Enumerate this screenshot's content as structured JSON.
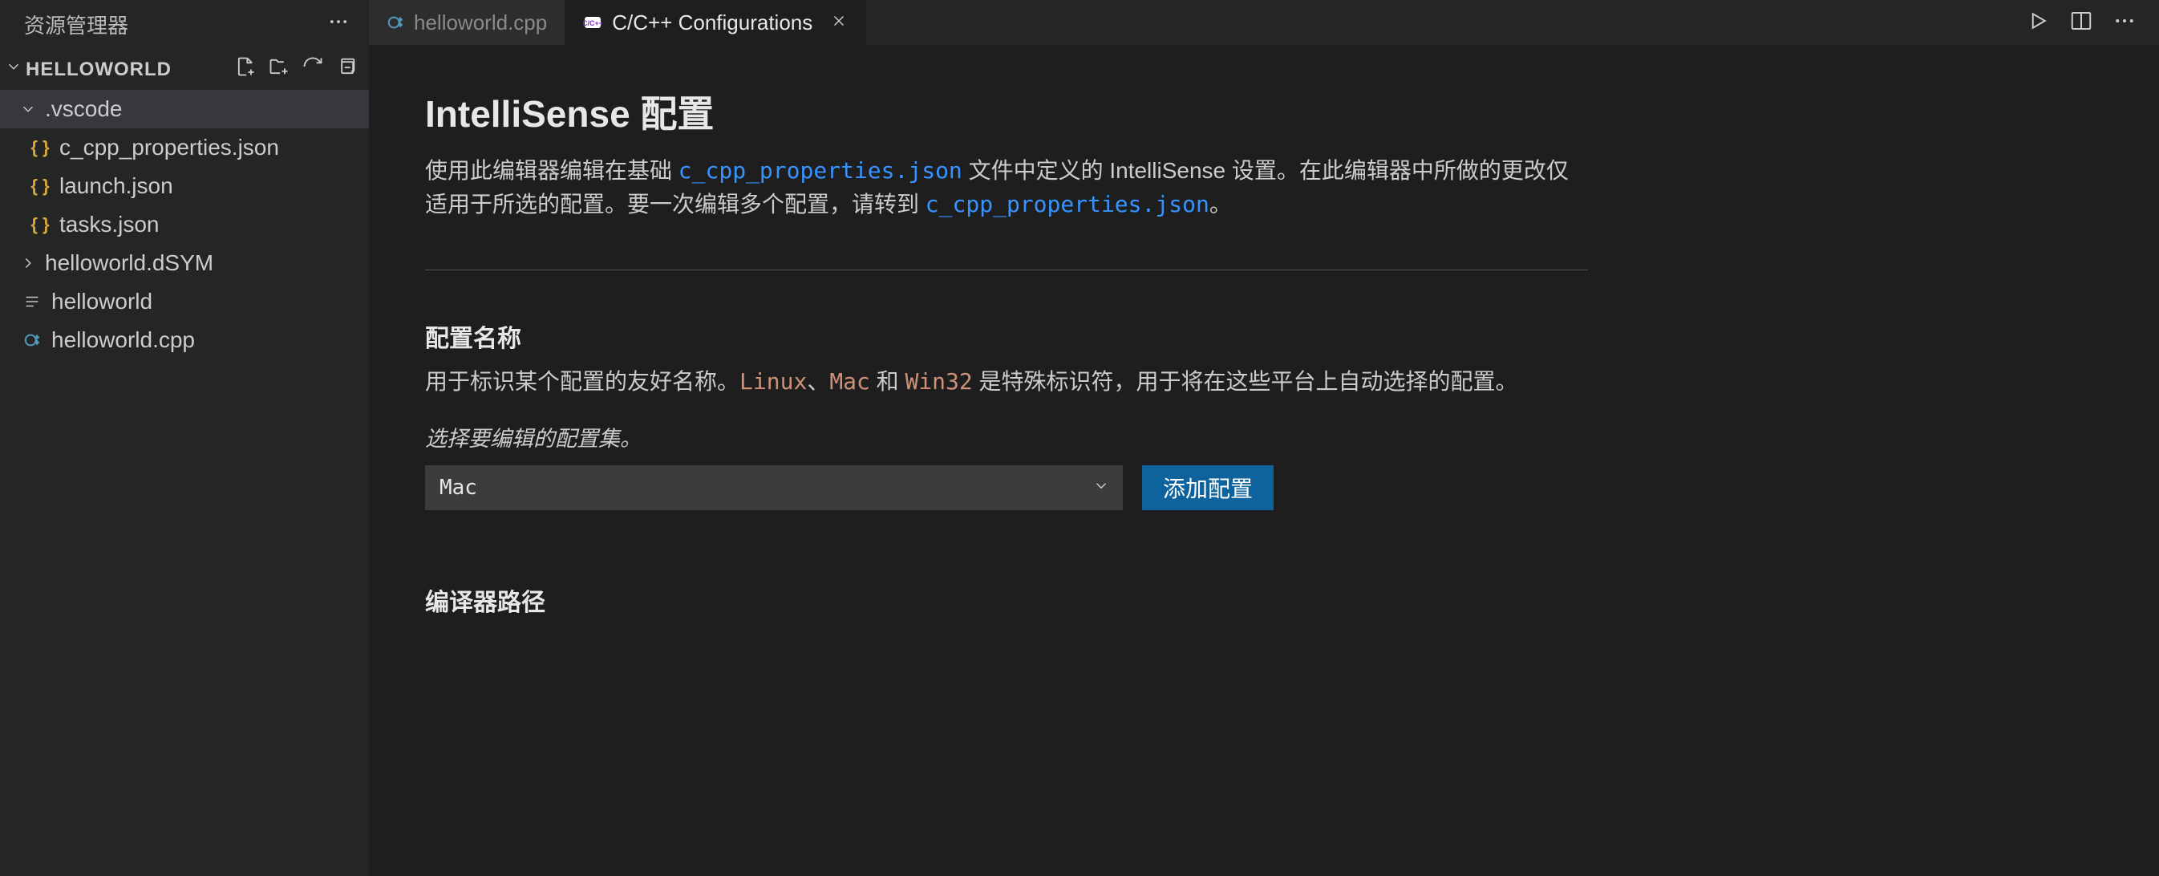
{
  "sidebar": {
    "title": "资源管理器",
    "project_name": "HELLOWORLD",
    "tree": [
      {
        "label": ".vscode",
        "type": "folder",
        "expanded": true,
        "selected": true
      },
      {
        "label": "c_cpp_properties.json",
        "type": "json",
        "child": true
      },
      {
        "label": "launch.json",
        "type": "json",
        "child": true
      },
      {
        "label": "tasks.json",
        "type": "json",
        "child": true
      },
      {
        "label": "helloworld.dSYM",
        "type": "folder",
        "expanded": false
      },
      {
        "label": "helloworld",
        "type": "text"
      },
      {
        "label": "helloworld.cpp",
        "type": "cpp"
      }
    ]
  },
  "tabs": [
    {
      "label": "helloworld.cpp",
      "icon": "cpp",
      "active": false
    },
    {
      "label": "C/C++ Configurations",
      "icon": "ccpp-config",
      "active": true
    }
  ],
  "page": {
    "title": "IntelliSense 配置",
    "desc_part1": "使用此编辑器编辑在基础 ",
    "desc_link1": "c_cpp_properties.json",
    "desc_part2": " 文件中定义的 IntelliSense 设置。在此编辑器中所做的更改仅适用于所选的配置。要一次编辑多个配置，请转到 ",
    "desc_link2": "c_cpp_properties.json",
    "desc_part3": "。",
    "section1": {
      "title": "配置名称",
      "desc_pre": "用于标识某个配置的友好名称。",
      "code1": "Linux",
      "sep1": "、",
      "code2": "Mac",
      "sep2": " 和 ",
      "code3": "Win32",
      "desc_post": " 是特殊标识符，用于将在这些平台上自动选择的配置。",
      "subtitle": "选择要编辑的配置集。",
      "selected": "Mac",
      "add_button": "添加配置"
    },
    "section2": {
      "title": "编译器路径"
    }
  }
}
